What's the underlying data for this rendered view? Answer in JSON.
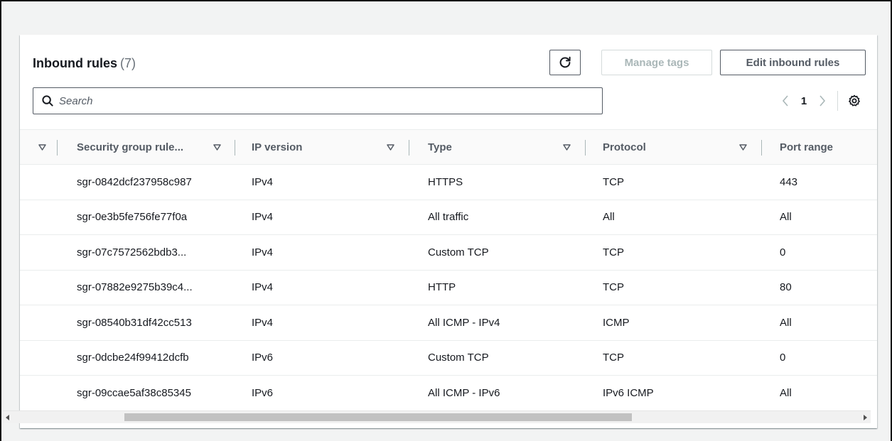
{
  "header": {
    "title": "Inbound rules",
    "count": "(7)",
    "manage_tags_label": "Manage tags",
    "edit_label": "Edit inbound rules"
  },
  "icons": {
    "refresh": "refresh-icon",
    "search": "search-icon",
    "prev": "chevron-left-icon",
    "next": "chevron-right-icon",
    "settings": "gear-icon",
    "sort": "sort-down-icon"
  },
  "search": {
    "placeholder": "Search"
  },
  "pagination": {
    "page": "1"
  },
  "columns": [
    "Security group rule...",
    "IP version",
    "Type",
    "Protocol",
    "Port range"
  ],
  "rows": [
    [
      "sgr-0842dcf237958c987",
      "IPv4",
      "HTTPS",
      "TCP",
      "443"
    ],
    [
      "sgr-0e3b5fe756fe77f0a",
      "IPv4",
      "All traffic",
      "All",
      "All"
    ],
    [
      "sgr-07c7572562bdb3...",
      "IPv4",
      "Custom TCP",
      "TCP",
      "0"
    ],
    [
      "sgr-07882e9275b39c4...",
      "IPv4",
      "HTTP",
      "TCP",
      "80"
    ],
    [
      "sgr-08540b31df42cc513",
      "IPv4",
      "All ICMP - IPv4",
      "ICMP",
      "All"
    ],
    [
      "sgr-0dcbe24f99412dcfb",
      "IPv6",
      "Custom TCP",
      "TCP",
      "0"
    ],
    [
      "sgr-09ccae5af38c85345",
      "IPv6",
      "All ICMP - IPv6",
      "IPv6 ICMP",
      "All"
    ]
  ],
  "colors": {
    "text": "#16191f",
    "muted": "#545b64",
    "disabled": "#aab7b8",
    "border": "#eaeded",
    "page_bg": "#f2f3f3"
  }
}
